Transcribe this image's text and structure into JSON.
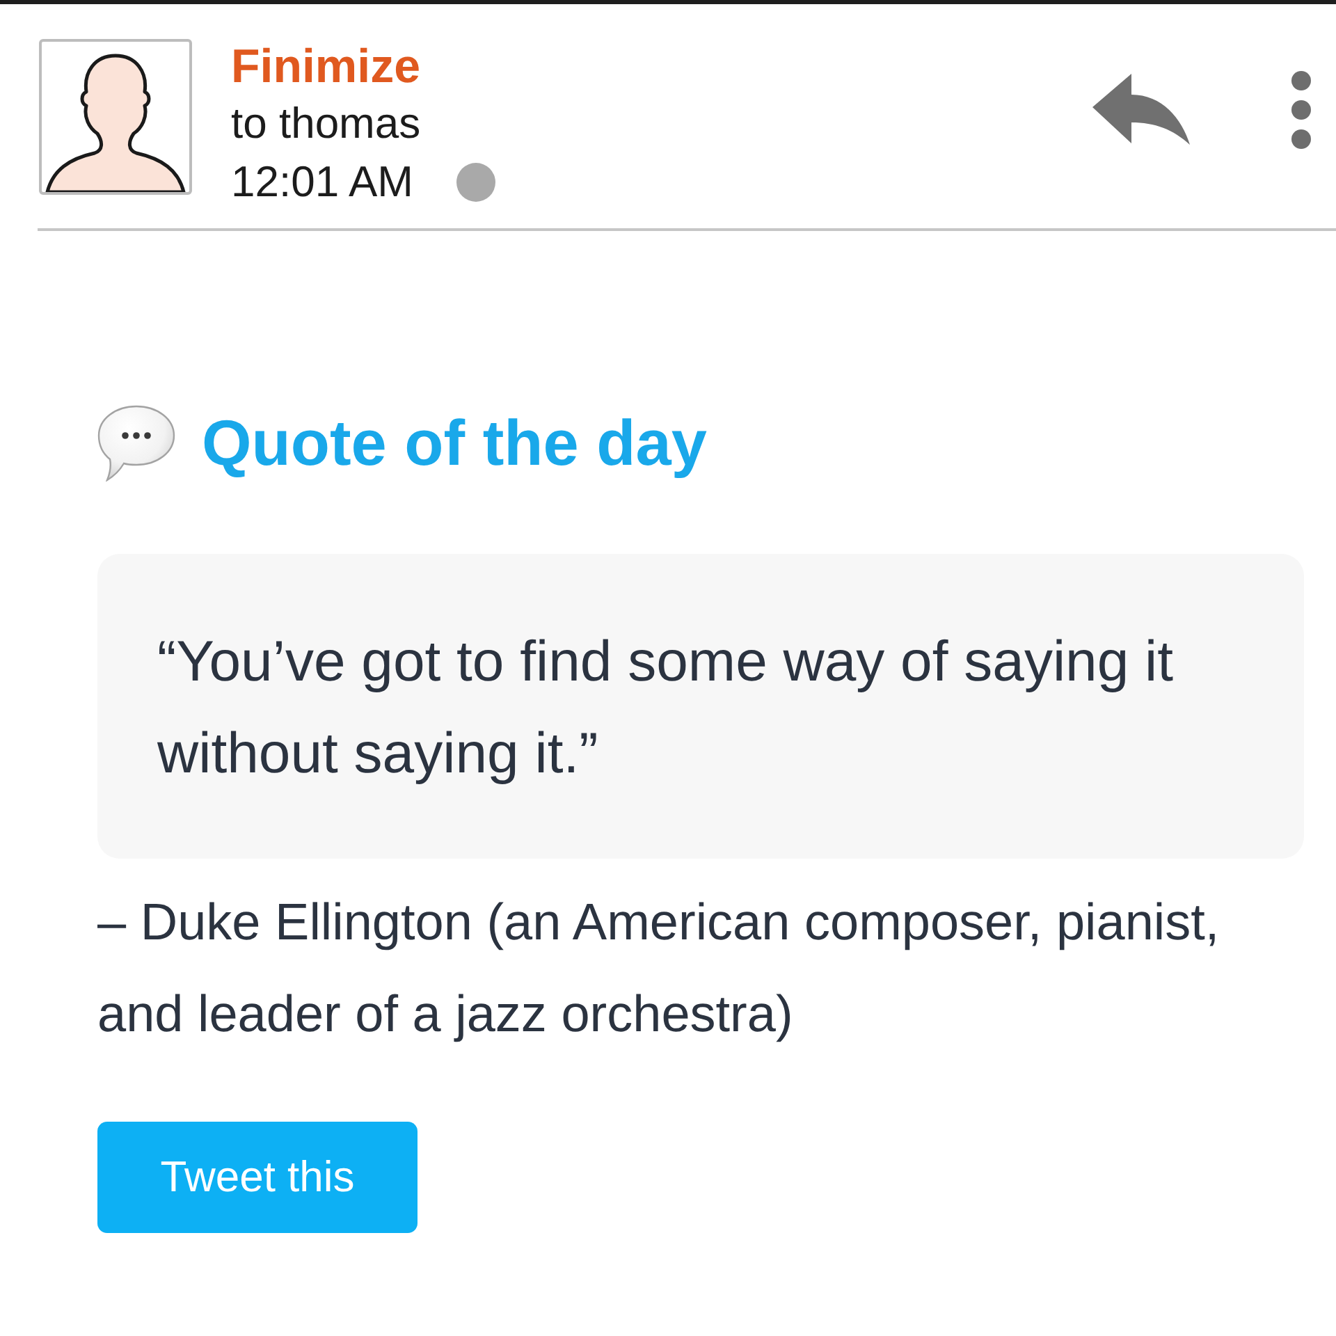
{
  "message_header": {
    "sender": "Finimize",
    "recipient": "to thomas",
    "time": "12:01 AM"
  },
  "section": {
    "heading": "Quote of the day",
    "quote": "“You’ve got to find some way of saying it without saying it.”",
    "attribution": "– Duke Ellington (an American composer, pianist, and leader of a jazz orchestra)",
    "button": "Tweet this"
  }
}
